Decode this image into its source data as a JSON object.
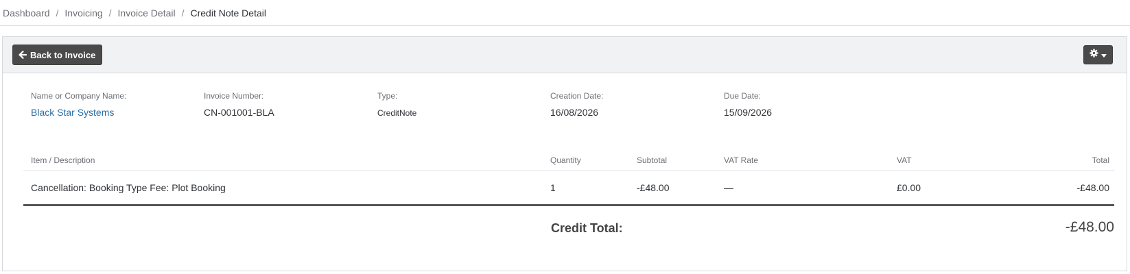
{
  "breadcrumb": {
    "items": [
      "Dashboard",
      "Invoicing",
      "Invoice Detail"
    ],
    "current": "Credit Note Detail",
    "separator": "/"
  },
  "toolbar": {
    "back_label": "Back to Invoice",
    "back_icon": "arrow-left-icon",
    "settings_icon": "gear-icon"
  },
  "info": {
    "name": {
      "label": "Name or Company Name:",
      "value": "Black Star Systems"
    },
    "invoice_number": {
      "label": "Invoice Number:",
      "value": "CN-001001-BLA"
    },
    "type": {
      "label": "Type:",
      "value": "CreditNote"
    },
    "creation_date": {
      "label": "Creation Date:",
      "value": "16/08/2026"
    },
    "due_date": {
      "label": "Due Date:",
      "value": "15/09/2026"
    }
  },
  "table": {
    "headers": {
      "item": "Item / Description",
      "quantity": "Quantity",
      "subtotal": "Subtotal",
      "vat_rate": "VAT Rate",
      "vat": "VAT",
      "total": "Total"
    },
    "rows": [
      {
        "item": "Cancellation: Booking Type Fee: Plot Booking",
        "quantity": "1",
        "subtotal": "-£48.00",
        "vat_rate": "—",
        "vat": "£0.00",
        "total": "-£48.00"
      }
    ]
  },
  "summary": {
    "label": "Credit Total:",
    "value": "-£48.00"
  },
  "colors": {
    "link": "#2a6fa8",
    "button": "#4a4a4a"
  }
}
